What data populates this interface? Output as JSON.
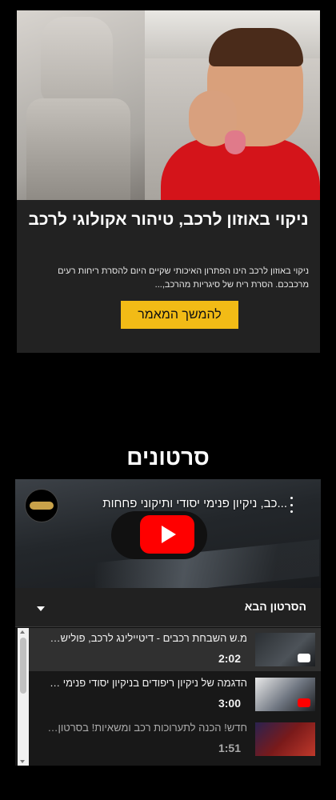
{
  "article": {
    "image_alt": "boy-holding-nose-in-car",
    "title": "ניקוי באוזון לרכב, טיהור אקולוגי לרכב",
    "excerpt": "ניקוי באוזון לרכב הינו הפתרון האיכותי שקיים היום להסרת ריחות רעים מרכבכם. הסרת ריח של סיגריות מהרכב,...",
    "read_more_label": "להמשך המאמר",
    "accent_color": "#f2bb16"
  },
  "videos": {
    "heading": "סרטונים",
    "player": {
      "video_title": "...כב, ניקיון פנימי יסודי ותיקוני פחחות",
      "play_icon": "youtube-play-icon",
      "menu_icon": "kebab-menu-icon",
      "next_label": "הסרטון הבא",
      "playlist": [
        {
          "title": "מ.ש השבחת רכבים - דיטיילינג לרכב, פוליש וו...",
          "duration": "2:02"
        },
        {
          "title": "הדגמה של ניקיון ריפודים בניקיון יסודי פנימי ש...",
          "duration": "3:00"
        },
        {
          "title": "חדש! הכנה לתערוכות רכב ומשאיות! בסרטון ...",
          "duration": "1:51"
        }
      ]
    }
  }
}
